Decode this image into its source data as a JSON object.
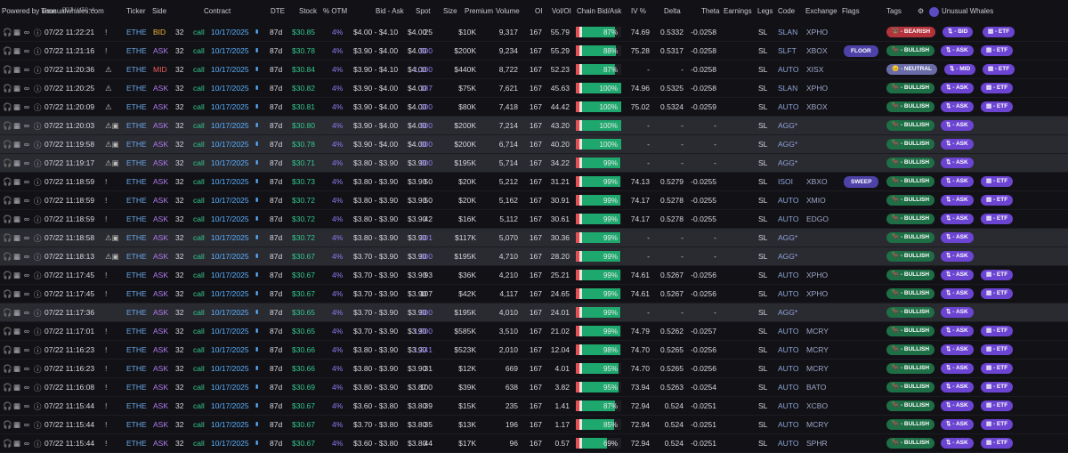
{
  "header": {
    "time_label": "Time",
    "tz_label": "EDT / UTC+4",
    "powered_by": "Powered by unusualwhales.com",
    "brand": "Unusual Whales",
    "columns": [
      "Ticker",
      "Side",
      "Contract",
      "DTE",
      "Stock",
      "% OTM",
      "Bid - Ask",
      "Spot",
      "Size",
      "Premium",
      "Volume",
      "OI",
      "Vol/OI",
      "Chain Bid/Ask",
      "IV %",
      "Delta",
      "Theta",
      "Earnings",
      "Legs",
      "Code",
      "Exchange",
      "Flags",
      "Tags"
    ]
  },
  "rows": [
    {
      "time": "07/22 11:22:21",
      "alert": "!",
      "ticker": "ETHE",
      "side": "BID",
      "strike": "32",
      "type": "call",
      "exp": "10/17/2025",
      "dte": "87d",
      "stock": "$30.85",
      "otm": "4%",
      "bidask": "$4.00 - $4.10",
      "spot": "$4.00",
      "size": "25",
      "prem": "$10K",
      "volume": "9,317",
      "oi": "167",
      "voloi": "55.79",
      "pct": "87%",
      "pctv": 87,
      "iv": "74.69",
      "delta": "0.5332",
      "theta": "-0.0258",
      "legs": "SL",
      "code": "SLAN",
      "exch": "XPHO",
      "flag": "",
      "tags": [
        "BEARISH",
        "BID",
        "ETF"
      ],
      "alt": false
    },
    {
      "time": "07/22 11:21:16",
      "alert": "!",
      "ticker": "ETHE",
      "side": "ASK",
      "strike": "32",
      "type": "call",
      "exp": "10/17/2025",
      "dte": "87d",
      "stock": "$30.78",
      "otm": "4%",
      "bidask": "$3.90 - $4.00",
      "spot": "$4.00",
      "size": "500",
      "prem": "$200K",
      "volume": "9,234",
      "oi": "167",
      "voloi": "55.29",
      "pct": "88%",
      "pctv": 88,
      "iv": "75.28",
      "delta": "0.5317",
      "theta": "-0.0258",
      "legs": "SL",
      "code": "SLFT",
      "exch": "XBOX",
      "flag": "FLOOR",
      "tags": [
        "BULLISH",
        "ASK",
        "ETF"
      ],
      "alt": false
    },
    {
      "time": "07/22 11:20:36",
      "alert": "⚠",
      "ticker": "ETHE",
      "side": "MID",
      "strike": "32",
      "type": "call",
      "exp": "10/17/2025",
      "dte": "87d",
      "stock": "$30.84",
      "otm": "4%",
      "bidask": "$3.90 - $4.10",
      "spot": "$4.00",
      "size": "1,100",
      "prem": "$440K",
      "volume": "8,722",
      "oi": "167",
      "voloi": "52.23",
      "pct": "87%",
      "pctv": 87,
      "iv": "-",
      "delta": "-",
      "theta": "-0.0258",
      "legs": "SL",
      "code": "AUTO",
      "exch": "XISX",
      "flag": "",
      "tags": [
        "NEUTRAL",
        "MID",
        "ETF"
      ],
      "alt": false
    },
    {
      "time": "07/22 11:20:25",
      "alert": "⚠",
      "ticker": "ETHE",
      "side": "ASK",
      "strike": "32",
      "type": "call",
      "exp": "10/17/2025",
      "dte": "87d",
      "stock": "$30.82",
      "otm": "4%",
      "bidask": "$3.90 - $4.00",
      "spot": "$4.00",
      "size": "187",
      "prem": "$75K",
      "volume": "7,621",
      "oi": "167",
      "voloi": "45.63",
      "pct": "100%",
      "pctv": 100,
      "iv": "74.96",
      "delta": "0.5325",
      "theta": "-0.0258",
      "legs": "SL",
      "code": "SLAN",
      "exch": "XPHO",
      "flag": "",
      "tags": [
        "BULLISH",
        "ASK",
        "ETF"
      ],
      "alt": false
    },
    {
      "time": "07/22 11:20:09",
      "alert": "⚠",
      "ticker": "ETHE",
      "side": "ASK",
      "strike": "32",
      "type": "call",
      "exp": "10/17/2025",
      "dte": "87d",
      "stock": "$30.81",
      "otm": "4%",
      "bidask": "$3.90 - $4.00",
      "spot": "$4.00",
      "size": "200",
      "prem": "$80K",
      "volume": "7,418",
      "oi": "167",
      "voloi": "44.42",
      "pct": "100%",
      "pctv": 100,
      "iv": "75.02",
      "delta": "0.5324",
      "theta": "-0.0259",
      "legs": "SL",
      "code": "AUTO",
      "exch": "XBOX",
      "flag": "",
      "tags": [
        "BULLISH",
        "ASK",
        "ETF"
      ],
      "alt": false
    },
    {
      "time": "07/22 11:20:03",
      "alert": "⚠▣",
      "ticker": "ETHE",
      "side": "ASK",
      "strike": "32",
      "type": "call",
      "exp": "10/17/2025",
      "dte": "87d",
      "stock": "$30.80",
      "otm": "4%",
      "bidask": "$3.90 - $4.00",
      "spot": "$4.00",
      "size": "500",
      "prem": "$200K",
      "volume": "7,214",
      "oi": "167",
      "voloi": "43.20",
      "pct": "100%",
      "pctv": 100,
      "iv": "-",
      "delta": "-",
      "theta": "-",
      "legs": "SL",
      "code": "AGG*",
      "exch": "",
      "flag": "",
      "tags": [
        "BULLISH",
        "ASK"
      ],
      "alt": true
    },
    {
      "time": "07/22 11:19:58",
      "alert": "⚠▣",
      "ticker": "ETHE",
      "side": "ASK",
      "strike": "32",
      "type": "call",
      "exp": "10/17/2025",
      "dte": "87d",
      "stock": "$30.78",
      "otm": "4%",
      "bidask": "$3.90 - $4.00",
      "spot": "$4.00",
      "size": "500",
      "prem": "$200K",
      "volume": "6,714",
      "oi": "167",
      "voloi": "40.20",
      "pct": "100%",
      "pctv": 100,
      "iv": "-",
      "delta": "-",
      "theta": "-",
      "legs": "SL",
      "code": "AGG*",
      "exch": "",
      "flag": "",
      "tags": [
        "BULLISH",
        "ASK"
      ],
      "alt": true
    },
    {
      "time": "07/22 11:19:17",
      "alert": "⚠▣",
      "ticker": "ETHE",
      "side": "ASK",
      "strike": "32",
      "type": "call",
      "exp": "10/17/2025",
      "dte": "87d",
      "stock": "$30.71",
      "otm": "4%",
      "bidask": "$3.80 - $3.90",
      "spot": "$3.90",
      "size": "500",
      "prem": "$195K",
      "volume": "5,714",
      "oi": "167",
      "voloi": "34.22",
      "pct": "99%",
      "pctv": 99,
      "iv": "-",
      "delta": "-",
      "theta": "-",
      "legs": "SL",
      "code": "AGG*",
      "exch": "",
      "flag": "",
      "tags": [
        "BULLISH",
        "ASK"
      ],
      "alt": true
    },
    {
      "time": "07/22 11:18:59",
      "alert": "!",
      "ticker": "ETHE",
      "side": "ASK",
      "strike": "32",
      "type": "call",
      "exp": "10/17/2025",
      "dte": "87d",
      "stock": "$30.73",
      "otm": "4%",
      "bidask": "$3.80 - $3.90",
      "spot": "$3.90",
      "size": "50",
      "prem": "$20K",
      "volume": "5,212",
      "oi": "167",
      "voloi": "31.21",
      "pct": "99%",
      "pctv": 99,
      "iv": "74.13",
      "delta": "0.5279",
      "theta": "-0.0255",
      "legs": "SL",
      "code": "ISOI",
      "exch": "XBXO",
      "flag": "SWEEP",
      "tags": [
        "BULLISH",
        "ASK",
        "ETF"
      ],
      "alt": false
    },
    {
      "time": "07/22 11:18:59",
      "alert": "!",
      "ticker": "ETHE",
      "side": "ASK",
      "strike": "32",
      "type": "call",
      "exp": "10/17/2025",
      "dte": "87d",
      "stock": "$30.72",
      "otm": "4%",
      "bidask": "$3.80 - $3.90",
      "spot": "$3.90",
      "size": "50",
      "prem": "$20K",
      "volume": "5,162",
      "oi": "167",
      "voloi": "30.91",
      "pct": "99%",
      "pctv": 99,
      "iv": "74.17",
      "delta": "0.5278",
      "theta": "-0.0255",
      "legs": "SL",
      "code": "AUTO",
      "exch": "XMIO",
      "flag": "",
      "tags": [
        "BULLISH",
        "ASK",
        "ETF"
      ],
      "alt": false
    },
    {
      "time": "07/22 11:18:59",
      "alert": "!",
      "ticker": "ETHE",
      "side": "ASK",
      "strike": "32",
      "type": "call",
      "exp": "10/17/2025",
      "dte": "87d",
      "stock": "$30.72",
      "otm": "4%",
      "bidask": "$3.80 - $3.90",
      "spot": "$3.90",
      "size": "42",
      "prem": "$16K",
      "volume": "5,112",
      "oi": "167",
      "voloi": "30.61",
      "pct": "99%",
      "pctv": 99,
      "iv": "74.17",
      "delta": "0.5278",
      "theta": "-0.0255",
      "legs": "SL",
      "code": "AUTO",
      "exch": "EDGO",
      "flag": "",
      "tags": [
        "BULLISH",
        "ASK",
        "ETF"
      ],
      "alt": false
    },
    {
      "time": "07/22 11:18:58",
      "alert": "⚠▣",
      "ticker": "ETHE",
      "side": "ASK",
      "strike": "32",
      "type": "call",
      "exp": "10/17/2025",
      "dte": "87d",
      "stock": "$30.72",
      "otm": "4%",
      "bidask": "$3.80 - $3.90",
      "spot": "$3.90",
      "size": "301",
      "prem": "$117K",
      "volume": "5,070",
      "oi": "167",
      "voloi": "30.36",
      "pct": "99%",
      "pctv": 99,
      "iv": "-",
      "delta": "-",
      "theta": "-",
      "legs": "SL",
      "code": "AGG*",
      "exch": "",
      "flag": "",
      "tags": [
        "BULLISH",
        "ASK"
      ],
      "alt": true
    },
    {
      "time": "07/22 11:18:13",
      "alert": "⚠▣",
      "ticker": "ETHE",
      "side": "ASK",
      "strike": "32",
      "type": "call",
      "exp": "10/17/2025",
      "dte": "87d",
      "stock": "$30.67",
      "otm": "4%",
      "bidask": "$3.70 - $3.90",
      "spot": "$3.90",
      "size": "500",
      "prem": "$195K",
      "volume": "4,710",
      "oi": "167",
      "voloi": "28.20",
      "pct": "99%",
      "pctv": 99,
      "iv": "-",
      "delta": "-",
      "theta": "-",
      "legs": "SL",
      "code": "AGG*",
      "exch": "",
      "flag": "",
      "tags": [
        "BULLISH",
        "ASK"
      ],
      "alt": true
    },
    {
      "time": "07/22 11:17:45",
      "alert": "!",
      "ticker": "ETHE",
      "side": "ASK",
      "strike": "32",
      "type": "call",
      "exp": "10/17/2025",
      "dte": "87d",
      "stock": "$30.67",
      "otm": "4%",
      "bidask": "$3.70 - $3.90",
      "spot": "$3.90",
      "size": "93",
      "prem": "$36K",
      "volume": "4,210",
      "oi": "167",
      "voloi": "25.21",
      "pct": "99%",
      "pctv": 99,
      "iv": "74.61",
      "delta": "0.5267",
      "theta": "-0.0256",
      "legs": "SL",
      "code": "AUTO",
      "exch": "XPHO",
      "flag": "",
      "tags": [
        "BULLISH",
        "ASK",
        "ETF"
      ],
      "alt": false
    },
    {
      "time": "07/22 11:17:45",
      "alert": "!",
      "ticker": "ETHE",
      "side": "ASK",
      "strike": "32",
      "type": "call",
      "exp": "10/17/2025",
      "dte": "87d",
      "stock": "$30.67",
      "otm": "4%",
      "bidask": "$3.70 - $3.90",
      "spot": "$3.90",
      "size": "107",
      "prem": "$42K",
      "volume": "4,117",
      "oi": "167",
      "voloi": "24.65",
      "pct": "99%",
      "pctv": 99,
      "iv": "74.61",
      "delta": "0.5267",
      "theta": "-0.0256",
      "legs": "SL",
      "code": "AUTO",
      "exch": "XPHO",
      "flag": "",
      "tags": [
        "BULLISH",
        "ASK",
        "ETF"
      ],
      "alt": false
    },
    {
      "time": "07/22 11:17:36",
      "alert": "",
      "ticker": "ETHE",
      "side": "ASK",
      "strike": "32",
      "type": "call",
      "exp": "10/17/2025",
      "dte": "87d",
      "stock": "$30.65",
      "otm": "4%",
      "bidask": "$3.70 - $3.90",
      "spot": "$3.90",
      "size": "500",
      "prem": "$195K",
      "volume": "4,010",
      "oi": "167",
      "voloi": "24.01",
      "pct": "99%",
      "pctv": 99,
      "iv": "-",
      "delta": "-",
      "theta": "-",
      "legs": "SL",
      "code": "AGG*",
      "exch": "",
      "flag": "",
      "tags": [
        "BULLISH",
        "ASK"
      ],
      "alt": true
    },
    {
      "time": "07/22 11:17:01",
      "alert": "!",
      "ticker": "ETHE",
      "side": "ASK",
      "strike": "32",
      "type": "call",
      "exp": "10/17/2025",
      "dte": "87d",
      "stock": "$30.65",
      "otm": "4%",
      "bidask": "$3.70 - $3.90",
      "spot": "$3.90",
      "size": "1,500",
      "prem": "$585K",
      "volume": "3,510",
      "oi": "167",
      "voloi": "21.02",
      "pct": "99%",
      "pctv": 99,
      "iv": "74.79",
      "delta": "0.5262",
      "theta": "-0.0257",
      "legs": "SL",
      "code": "AUTO",
      "exch": "MCRY",
      "flag": "",
      "tags": [
        "BULLISH",
        "ASK",
        "ETF"
      ],
      "alt": false
    },
    {
      "time": "07/22 11:16:23",
      "alert": "!",
      "ticker": "ETHE",
      "side": "ASK",
      "strike": "32",
      "type": "call",
      "exp": "10/17/2025",
      "dte": "87d",
      "stock": "$30.66",
      "otm": "4%",
      "bidask": "$3.80 - $3.90",
      "spot": "$3.90",
      "size": "1,341",
      "prem": "$523K",
      "volume": "2,010",
      "oi": "167",
      "voloi": "12.04",
      "pct": "98%",
      "pctv": 98,
      "iv": "74.70",
      "delta": "0.5265",
      "theta": "-0.0256",
      "legs": "SL",
      "code": "AUTO",
      "exch": "MCRY",
      "flag": "",
      "tags": [
        "BULLISH",
        "ASK",
        "ETF"
      ],
      "alt": false
    },
    {
      "time": "07/22 11:16:23",
      "alert": "!",
      "ticker": "ETHE",
      "side": "ASK",
      "strike": "32",
      "type": "call",
      "exp": "10/17/2025",
      "dte": "87d",
      "stock": "$30.66",
      "otm": "4%",
      "bidask": "$3.80 - $3.90",
      "spot": "$3.90",
      "size": "31",
      "prem": "$12K",
      "volume": "669",
      "oi": "167",
      "voloi": "4.01",
      "pct": "95%",
      "pctv": 95,
      "iv": "74.70",
      "delta": "0.5265",
      "theta": "-0.0256",
      "legs": "SL",
      "code": "AUTO",
      "exch": "MCRY",
      "flag": "",
      "tags": [
        "BULLISH",
        "ASK",
        "ETF"
      ],
      "alt": false
    },
    {
      "time": "07/22 11:16:08",
      "alert": "!",
      "ticker": "ETHE",
      "side": "ASK",
      "strike": "32",
      "type": "call",
      "exp": "10/17/2025",
      "dte": "87d",
      "stock": "$30.69",
      "otm": "4%",
      "bidask": "$3.80 - $3.90",
      "spot": "$3.87",
      "size": "100",
      "prem": "$39K",
      "volume": "638",
      "oi": "167",
      "voloi": "3.82",
      "pct": "95%",
      "pctv": 95,
      "iv": "73.94",
      "delta": "0.5263",
      "theta": "-0.0254",
      "legs": "SL",
      "code": "AUTO",
      "exch": "BATO",
      "flag": "",
      "tags": [
        "BULLISH",
        "ASK",
        "ETF"
      ],
      "alt": false
    },
    {
      "time": "07/22 11:15:44",
      "alert": "!",
      "ticker": "ETHE",
      "side": "ASK",
      "strike": "32",
      "type": "call",
      "exp": "10/17/2025",
      "dte": "87d",
      "stock": "$30.67",
      "otm": "4%",
      "bidask": "$3.60 - $3.80",
      "spot": "$3.80",
      "size": "39",
      "prem": "$15K",
      "volume": "235",
      "oi": "167",
      "voloi": "1.41",
      "pct": "87%",
      "pctv": 87,
      "iv": "72.94",
      "delta": "0.524",
      "theta": "-0.0251",
      "legs": "SL",
      "code": "AUTO",
      "exch": "XCBO",
      "flag": "",
      "tags": [
        "BULLISH",
        "ASK",
        "ETF"
      ],
      "alt": false
    },
    {
      "time": "07/22 11:15:44",
      "alert": "!",
      "ticker": "ETHE",
      "side": "ASK",
      "strike": "32",
      "type": "call",
      "exp": "10/17/2025",
      "dte": "87d",
      "stock": "$30.67",
      "otm": "4%",
      "bidask": "$3.70 - $3.80",
      "spot": "$3.80",
      "size": "35",
      "prem": "$13K",
      "volume": "196",
      "oi": "167",
      "voloi": "1.17",
      "pct": "85%",
      "pctv": 85,
      "iv": "72.94",
      "delta": "0.524",
      "theta": "-0.0251",
      "legs": "SL",
      "code": "AUTO",
      "exch": "MCRY",
      "flag": "",
      "tags": [
        "BULLISH",
        "ASK",
        "ETF"
      ],
      "alt": false
    },
    {
      "time": "07/22 11:15:44",
      "alert": "!",
      "ticker": "ETHE",
      "side": "ASK",
      "strike": "32",
      "type": "call",
      "exp": "10/17/2025",
      "dte": "87d",
      "stock": "$30.67",
      "otm": "4%",
      "bidask": "$3.60 - $3.80",
      "spot": "$3.80",
      "size": "44",
      "prem": "$17K",
      "volume": "96",
      "oi": "167",
      "voloi": "0.57",
      "pct": "69%",
      "pctv": 69,
      "iv": "72.94",
      "delta": "0.524",
      "theta": "-0.0251",
      "legs": "SL",
      "code": "AUTO",
      "exch": "SPHR",
      "flag": "",
      "tags": [
        "BULLISH",
        "ASK",
        "ETF"
      ],
      "alt": false
    }
  ]
}
